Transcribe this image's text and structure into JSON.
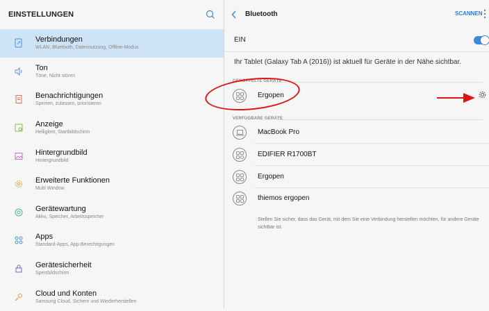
{
  "left": {
    "title": "EINSTELLUNGEN",
    "items": [
      {
        "title": "Verbindungen",
        "sub": "WLAN, Bluetooth, Datennutzung, Offline-Modus",
        "icon": "connections-icon"
      },
      {
        "title": "Ton",
        "sub": "Töne, Nicht stören",
        "icon": "sound-icon"
      },
      {
        "title": "Benachrichtigungen",
        "sub": "Sperren, zulassen, priorisieren",
        "icon": "notifications-icon"
      },
      {
        "title": "Anzeige",
        "sub": "Helligkeit, Startbildschirm",
        "icon": "display-icon"
      },
      {
        "title": "Hintergrundbild",
        "sub": "Hintergrundbild",
        "icon": "wallpaper-icon"
      },
      {
        "title": "Erweiterte Funktionen",
        "sub": "Multi Window",
        "icon": "advanced-features-icon"
      },
      {
        "title": "Gerätewartung",
        "sub": "Akku, Speicher, Arbeitsspeicher",
        "icon": "device-maintenance-icon"
      },
      {
        "title": "Apps",
        "sub": "Standard-Apps, App-Berechtigungen",
        "icon": "apps-icon"
      },
      {
        "title": "Gerätesicherheit",
        "sub": "Sperrbildschirm",
        "icon": "lock-icon"
      },
      {
        "title": "Cloud und Konten",
        "sub": "Samsung Cloud, Sichern und Wiederherstellen",
        "icon": "key-icon"
      }
    ]
  },
  "right": {
    "title": "Bluetooth",
    "scan_label": "SCANNEN",
    "ein_label": "EIN",
    "toggle_on": true,
    "visible_text": "Ihr Tablet (Galaxy Tab A (2016)) ist aktuell für Geräte in der Nähe sichtbar.",
    "paired_label": "GEKOPPELTE GERÄTE",
    "paired": [
      {
        "name": "Ergopen",
        "icon": "pen-device-icon"
      }
    ],
    "available_label": "VERFÜGBARE GERÄTE",
    "available": [
      {
        "name": "MacBook Pro",
        "icon": "laptop-icon"
      },
      {
        "name": "EDIFIER R1700BT",
        "icon": "speaker-device-icon"
      },
      {
        "name": "Ergopen",
        "icon": "pen-device-icon"
      },
      {
        "name": "thiemos ergopen",
        "icon": "pen-device-icon"
      }
    ],
    "info": "Stellen Sie sicher, dass das Gerät, mit dem Sie eine Verbindung herstellen möchten, für andere Geräte sichtbar ist."
  },
  "colors": {
    "accent": "#2f7bd6",
    "selected": "#cfe3f7",
    "annotation": "#e01414"
  }
}
